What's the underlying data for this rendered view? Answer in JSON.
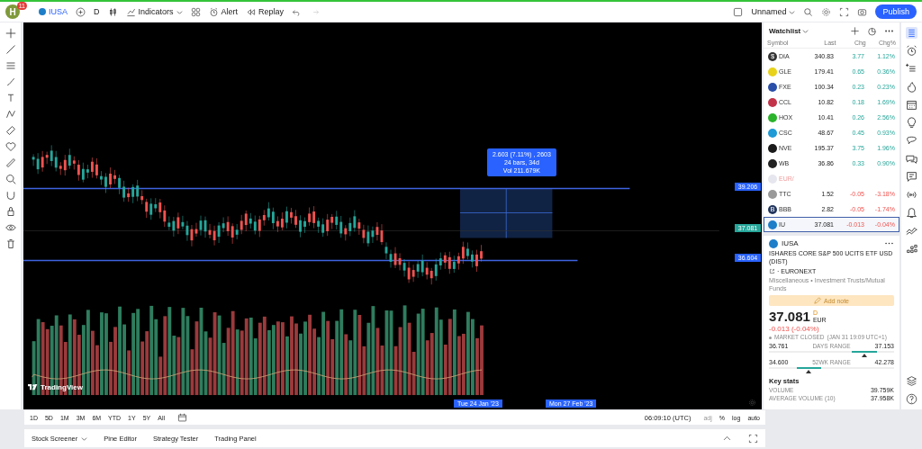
{
  "top_bar": {
    "avatar": "H",
    "notifications": "11",
    "symbol": "IUSA",
    "interval": "D",
    "indicators": "Indicators",
    "alert": "Alert",
    "replay": "Replay",
    "layout": "Unnamed",
    "publish": "Publish"
  },
  "chart": {
    "measure": [
      "2.603 (7.11%) , 2603",
      "24 bars, 34d",
      "Vol 211.679K"
    ],
    "price_tags": [
      {
        "text": "39.206",
        "kind": "line"
      },
      {
        "text": "37.081",
        "kind": "last"
      },
      {
        "text": "36.604",
        "kind": "line"
      }
    ],
    "time_tags": [
      "Tue 24 Jan '23",
      "Mon 27 Feb '23"
    ],
    "logo": "TradingView"
  },
  "range_bar": {
    "ranges": [
      "1D",
      "5D",
      "1M",
      "3M",
      "6M",
      "YTD",
      "1Y",
      "5Y",
      "All"
    ],
    "clock": "06:09:10 (UTC)",
    "options": [
      {
        "label": "adj",
        "disabled": true
      },
      {
        "label": "%",
        "disabled": false
      },
      {
        "label": "log",
        "disabled": false
      },
      {
        "label": "auto",
        "disabled": false
      }
    ]
  },
  "bottom_tabs": [
    "Stock Screener",
    "Pine Editor",
    "Strategy Tester",
    "Trading Panel"
  ],
  "watchlist": {
    "title": "Watchlist",
    "columns": [
      "Symbol",
      "Last",
      "Chg",
      "Chg%"
    ],
    "rows": [
      {
        "symbol": "DIA",
        "glyph": "$",
        "color": "#333333",
        "last": "340.83",
        "chg": "3.77",
        "chgp": "1.12%",
        "selected": false,
        "kind": "quote"
      },
      {
        "symbol": "GLE",
        "glyph": "",
        "color": "#e8d21a",
        "last": "179.41",
        "chg": "0.65",
        "chgp": "0.36%",
        "selected": false,
        "kind": "quote"
      },
      {
        "symbol": "FXE",
        "glyph": "",
        "color": "#2a4fa8",
        "last": "100.34",
        "chg": "0.23",
        "chgp": "0.23%",
        "selected": false,
        "kind": "quote"
      },
      {
        "symbol": "CCL",
        "glyph": "",
        "color": "#c2334a",
        "last": "10.82",
        "chg": "0.18",
        "chgp": "1.69%",
        "selected": false,
        "kind": "quote"
      },
      {
        "symbol": "HOX",
        "glyph": "",
        "color": "#2bb32b",
        "last": "10.41",
        "chg": "0.26",
        "chgp": "2.56%",
        "selected": false,
        "kind": "quote"
      },
      {
        "symbol": "CSC",
        "glyph": "",
        "color": "#1e9ad6",
        "last": "48.67",
        "chg": "0.45",
        "chgp": "0.93%",
        "selected": false,
        "kind": "quote"
      },
      {
        "symbol": "NVE",
        "glyph": "",
        "color": "#1a1a1a",
        "last": "195.37",
        "chg": "3.75",
        "chgp": "1.96%",
        "selected": false,
        "kind": "quote"
      },
      {
        "symbol": "WB",
        "glyph": "",
        "color": "#222222",
        "last": "36.86",
        "chg": "0.33",
        "chgp": "0.90%",
        "selected": false,
        "kind": "quote"
      },
      {
        "symbol": "EUR/",
        "glyph": "",
        "color": "#e6e6ee",
        "kind": "section",
        "selected": false
      },
      {
        "symbol": "TTC",
        "glyph": "",
        "color": "#999999",
        "last": "1.52",
        "chg": "-0.05",
        "chgp": "-3.18%",
        "selected": false,
        "kind": "quote"
      },
      {
        "symbol": "BBB",
        "glyph": "B",
        "color": "#23365e",
        "last": "2.82",
        "chg": "-0.05",
        "chgp": "-1.74%",
        "selected": false,
        "kind": "quote"
      },
      {
        "symbol": "IU",
        "glyph": "",
        "color": "#1e7ec8",
        "last": "37.081",
        "chg": "-0.013",
        "chgp": "-0.04%",
        "selected": true,
        "kind": "quote"
      }
    ]
  },
  "details": {
    "symbol": "IUSA",
    "name": "ISHARES CORE S&P 500 UCITS ETF USD (DIST)",
    "exchange": "· EURONEXT",
    "category": "Miscellaneous • Investment Trusts/Mutual Funds",
    "add_note": "Add note",
    "price": "37.081",
    "price_mark": "D",
    "currency": "EUR",
    "change": "-0.013 (-0.04%)",
    "status": "MARKET CLOSED",
    "status_time": "(JAN 31 19:09 UTC+1)",
    "ranges": [
      {
        "low": "36.761",
        "label": "DAYS RANGE",
        "high": "37.153",
        "level": 0.76
      },
      {
        "low": "34.600",
        "label": "52WK RANGE",
        "high": "42.278",
        "level": 0.32
      }
    ],
    "key_stats_title": "Key stats",
    "stats": [
      {
        "label": "VOLUME",
        "value": "39.759K"
      },
      {
        "label": "AVERAGE VOLUME (10)",
        "value": "37.958K"
      }
    ]
  }
}
